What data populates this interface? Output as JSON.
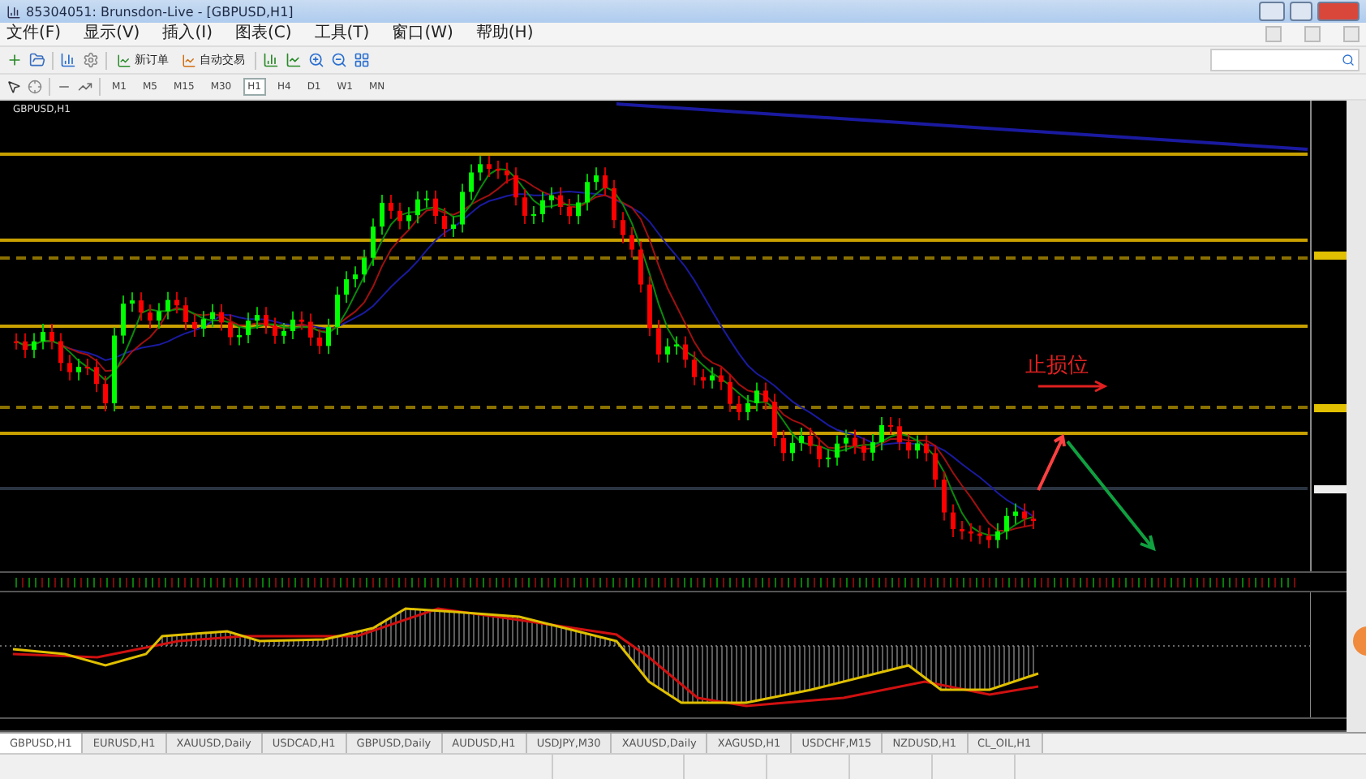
{
  "window": {
    "title": "85304051: Brunsdon-Live - [GBPUSD,H1]"
  },
  "menu": [
    "文件(F)",
    "显示(V)",
    "插入(I)",
    "图表(C)",
    "工具(T)",
    "窗口(W)",
    "帮助(H)"
  ],
  "toolbar": {
    "buttons": [
      {
        "label": "新订单"
      },
      {
        "label": "自动交易"
      }
    ]
  },
  "timeframes": [
    {
      "label": "M1",
      "selected": false
    },
    {
      "label": "M5",
      "selected": false
    },
    {
      "label": "M15",
      "selected": false
    },
    {
      "label": "M30",
      "selected": false
    },
    {
      "label": "H1",
      "selected": true
    },
    {
      "label": "H4",
      "selected": false
    },
    {
      "label": "D1",
      "selected": false
    },
    {
      "label": "W1",
      "selected": false
    },
    {
      "label": "MN",
      "selected": false
    }
  ],
  "chart": {
    "symbol": "GBPUSD,H1",
    "annotation": "止损位"
  },
  "tabs": [
    {
      "label": "GBPUSD,H1",
      "selected": true
    },
    {
      "label": "EURUSD,H1",
      "selected": false
    },
    {
      "label": "XAUUSD,Daily",
      "selected": false
    },
    {
      "label": "USDCAD,H1",
      "selected": false
    },
    {
      "label": "GBPUSD,Daily",
      "selected": false
    },
    {
      "label": "AUDUSD,H1",
      "selected": false
    },
    {
      "label": "USDJPY,M30",
      "selected": false
    },
    {
      "label": "XAUUSD,Daily",
      "selected": false
    },
    {
      "label": "XAGUSD,H1",
      "selected": false
    },
    {
      "label": "USDCHF,M15",
      "selected": false
    },
    {
      "label": "NZDUSD,H1",
      "selected": false
    },
    {
      "label": "CL_OIL,H1",
      "selected": false
    }
  ]
}
